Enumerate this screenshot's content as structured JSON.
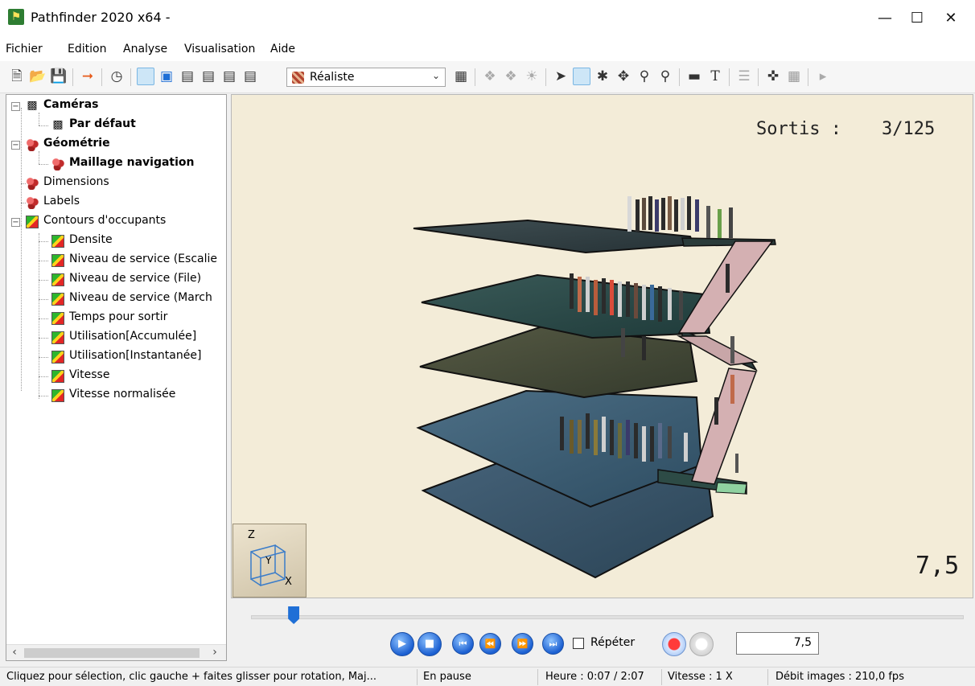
{
  "window": {
    "title": "Pathfinder 2020 x64 -"
  },
  "menu": [
    "Fichier",
    "Edition",
    "Analyse",
    "Visualisation",
    "Aide"
  ],
  "toolbar": {
    "render_mode": "Réaliste"
  },
  "tree": {
    "cameras": "Caméras",
    "camera_default": "Par défaut",
    "geometry": "Géométrie",
    "nav_mesh": "Maillage navigation",
    "dimensions": "Dimensions",
    "labels": "Labels",
    "contours": "Contours d'occupants",
    "contour_items": [
      "Densite",
      "Niveau de service (Escalie",
      "Niveau de service (File)",
      "Niveau de service (March",
      "Temps pour sortir",
      "Utilisation[Accumulée]",
      "Utilisation[Instantanée]",
      "Vitesse",
      "Vitesse normalisée"
    ]
  },
  "viewport": {
    "sortis_label": "Sortis :",
    "sortis_value": "3/125",
    "time_overlay": "7,5",
    "axis_z": "Z",
    "axis_y": "Y",
    "axis_x": "X"
  },
  "playback": {
    "progress": 0.06,
    "repeat_label": "Répéter",
    "time_value": "7,5"
  },
  "status": {
    "hint": "Cliquez pour sélection, clic gauche + faites glisser pour rotation, Maj...",
    "state": "En pause",
    "time": "Heure : 0:07 / 2:07",
    "speed": "Vitesse : 1 X",
    "fps": "Débit images : 210,0 fps"
  }
}
